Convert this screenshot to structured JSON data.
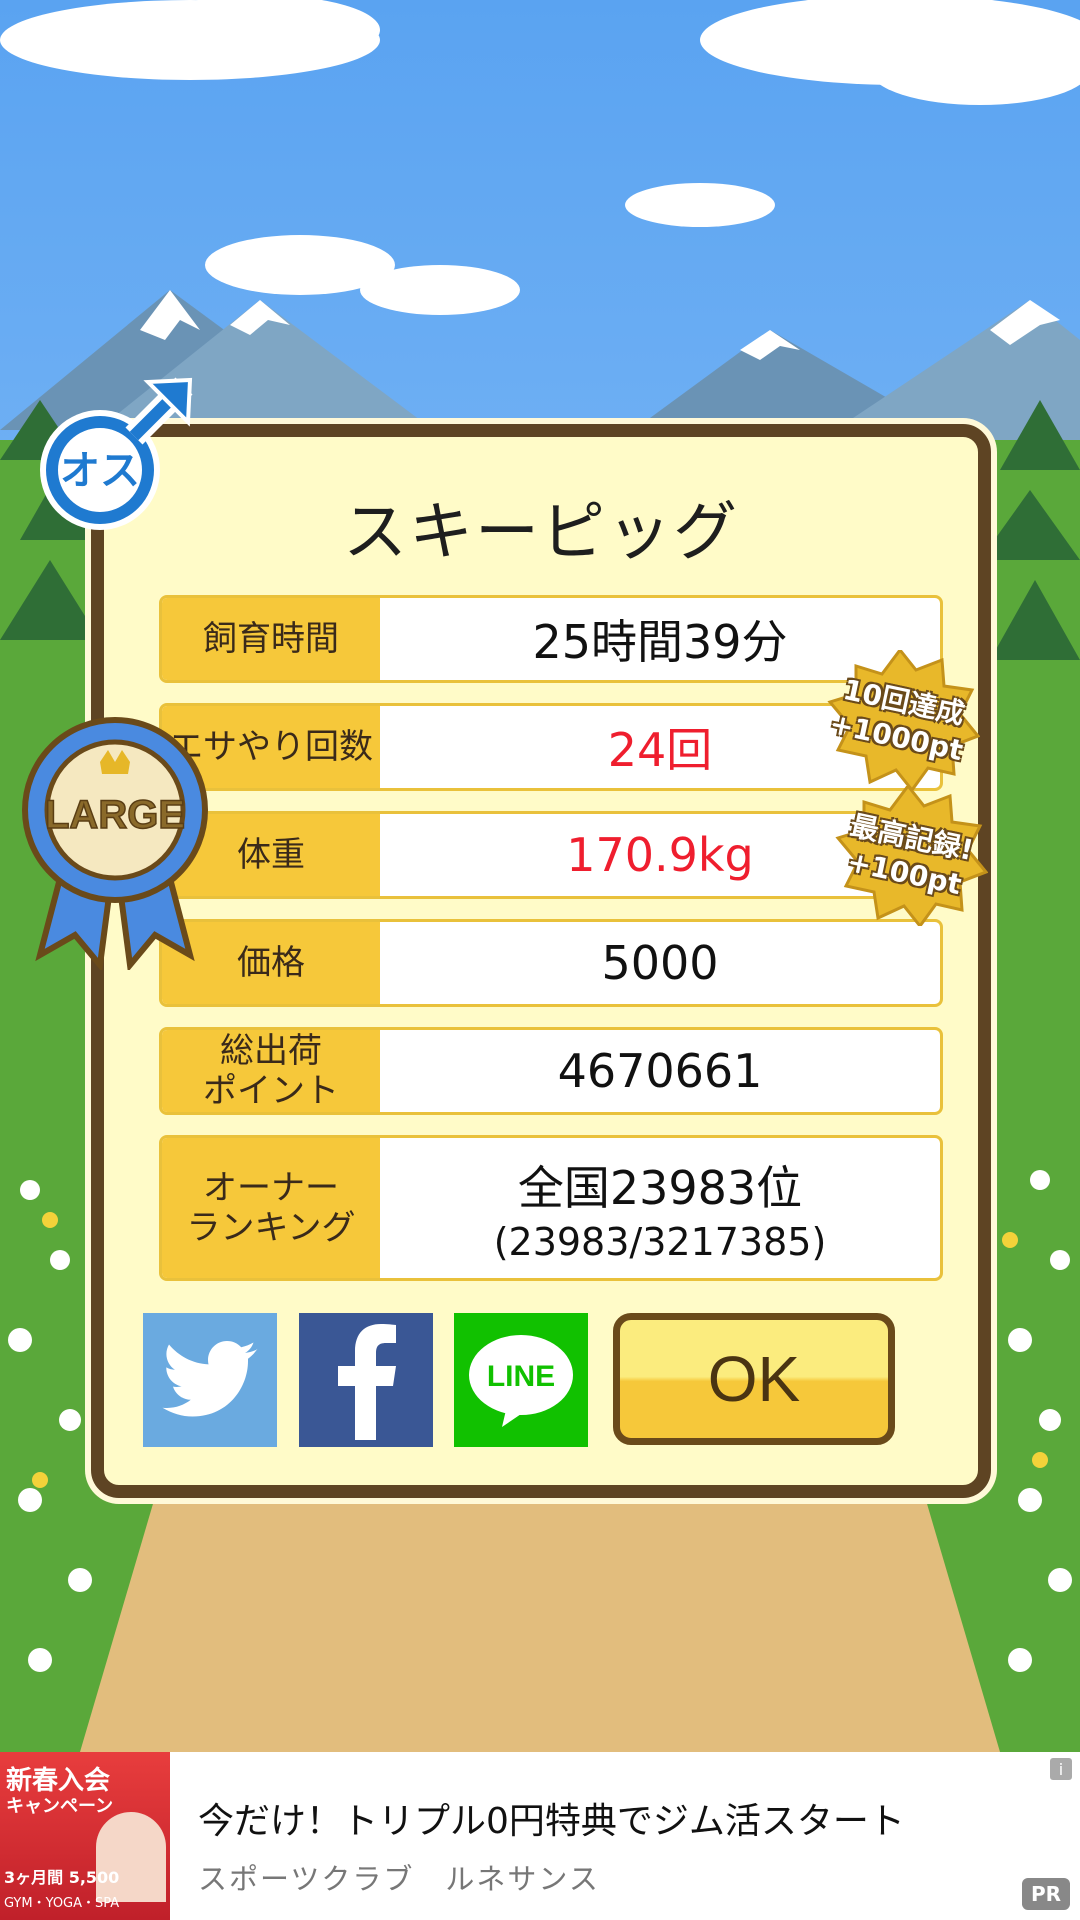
{
  "dialog": {
    "title": "スキーピッグ",
    "rows": [
      {
        "label": "飼育時間",
        "value": "25時間39分",
        "highlight": false
      },
      {
        "label": "エサやり回数",
        "value": "24回",
        "highlight": true
      },
      {
        "label": "体重",
        "value": "170.9kg",
        "highlight": true
      },
      {
        "label": "価格",
        "value": "5000",
        "highlight": false
      },
      {
        "label": "総出荷\nポイント",
        "value": "4670661",
        "highlight": false
      },
      {
        "label": "オーナー\nランキング",
        "value": "全国23983位",
        "subvalue": "(23983/3217385)",
        "highlight": false
      }
    ],
    "ok_label": "OK",
    "social": {
      "twitter": "twitter-icon",
      "facebook": "facebook-icon",
      "line_label": "LINE"
    }
  },
  "badges": {
    "gender": "オス",
    "size_ribbon": "LARGE",
    "bonus1": {
      "line1": "10回達成",
      "line2": "+1000pt"
    },
    "bonus2": {
      "line1": "最高記録!",
      "line2": "+100pt"
    }
  },
  "ad": {
    "title": "今だけ！トリプル0円特典でジム活スタート",
    "sponsor": "スポーツクラブ　ルネサンス",
    "pr_label": "PR",
    "info_icon": "i",
    "image_text": {
      "headline": "新春入会",
      "sub": "キャンペーン",
      "price": "3ヶ月間 5,500",
      "footer": "GYM・YOGA・SPA"
    }
  },
  "colors": {
    "accent_yellow": "#f6c83a",
    "highlight_red": "#ef1e2e",
    "frame_brown": "#5e4423",
    "panel_cream": "#fffbc8"
  }
}
